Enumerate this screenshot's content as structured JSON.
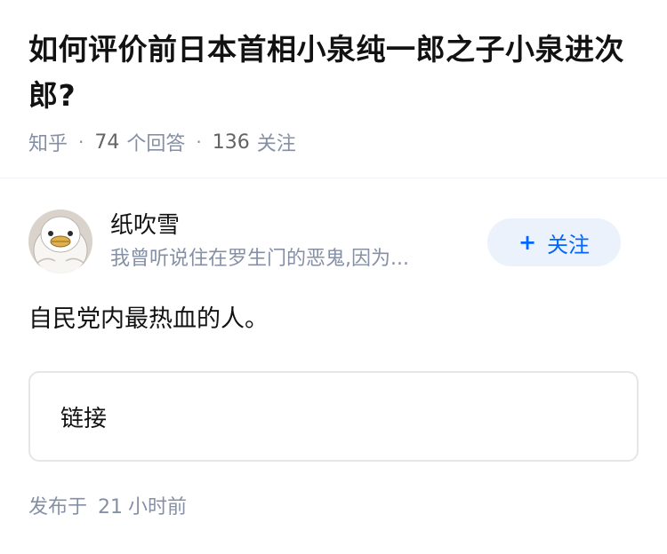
{
  "question": {
    "title": "如何评价前日本首相小泉纯一郎之子小泉进次郎?",
    "source": "知乎",
    "answers_count": "74",
    "answers_label": "个回答",
    "followers_count": "136",
    "followers_label": "关注"
  },
  "author": {
    "name": "纸吹雪",
    "bio": "我曾听说住在罗生门的恶鬼,因为...",
    "follow_plus": "+",
    "follow_label": "关注",
    "avatar_icon": "white-duck-avatar"
  },
  "answer": {
    "content": "自民党内最热血的人。",
    "link_card_label": "链接"
  },
  "footer": {
    "posted_prefix": "发布于",
    "posted_value": "21",
    "posted_suffix": "小时前"
  },
  "colors": {
    "accent": "#0066ff",
    "follow_bg": "#ebf2fb",
    "muted_text": "#8590a6"
  }
}
